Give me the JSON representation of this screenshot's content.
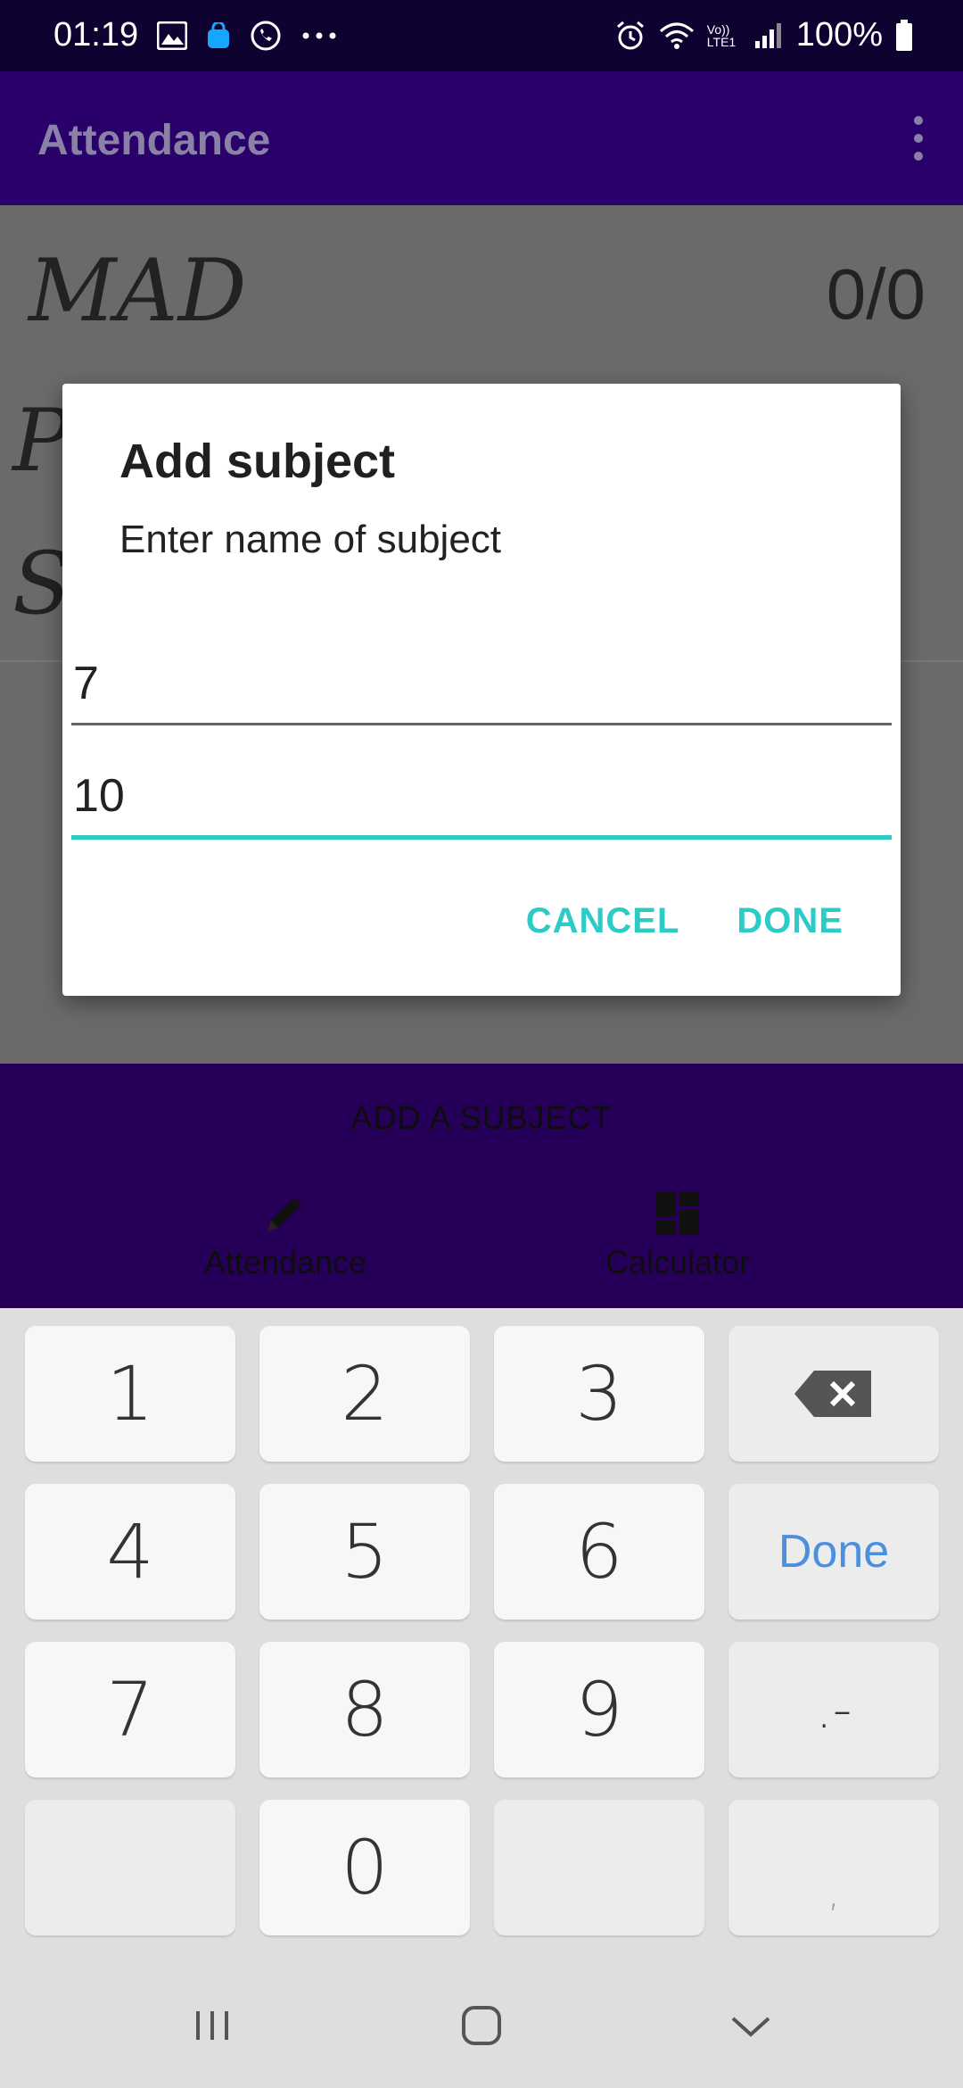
{
  "status_bar": {
    "time": "01:19",
    "battery": "100%",
    "left_icons": [
      "gallery-icon",
      "store-icon",
      "whatsapp-icon",
      "more-icon"
    ],
    "right_icons": [
      "alarm-icon",
      "wifi-icon",
      "volte-icon",
      "signal-icon",
      "battery-icon"
    ],
    "volte_label": "Vo)) LTE1"
  },
  "app_bar": {
    "title": "Attendance",
    "overflow": "more-vert-icon"
  },
  "subjects": [
    {
      "name": "MAD",
      "count": "0/0"
    },
    {
      "name": "P",
      "count": ""
    },
    {
      "name": "S",
      "count": ""
    }
  ],
  "dialog": {
    "title": "Add subject",
    "message": "Enter name of subject",
    "field1_value": "7",
    "field2_value": "10",
    "cancel_label": "CANCEL",
    "done_label": "DONE",
    "accent": "#2ccbc5"
  },
  "bottom": {
    "add_subject_label": "ADD A SUBJECT",
    "nav": [
      {
        "label": "Attendance",
        "icon": "pencil-icon"
      },
      {
        "label": "Calculator",
        "icon": "dashboard-icon"
      }
    ]
  },
  "keyboard": {
    "keys": [
      "1",
      "2",
      "3",
      "⌫",
      "4",
      "5",
      "6",
      "Done",
      "7",
      "8",
      "9",
      ".-",
      "",
      "0",
      "",
      ","
    ]
  },
  "colors": {
    "status_bar": "#0e0330",
    "app_bar": "#2a006b",
    "bottom_panel": "#260058",
    "done_key": "#4a8fe0"
  }
}
